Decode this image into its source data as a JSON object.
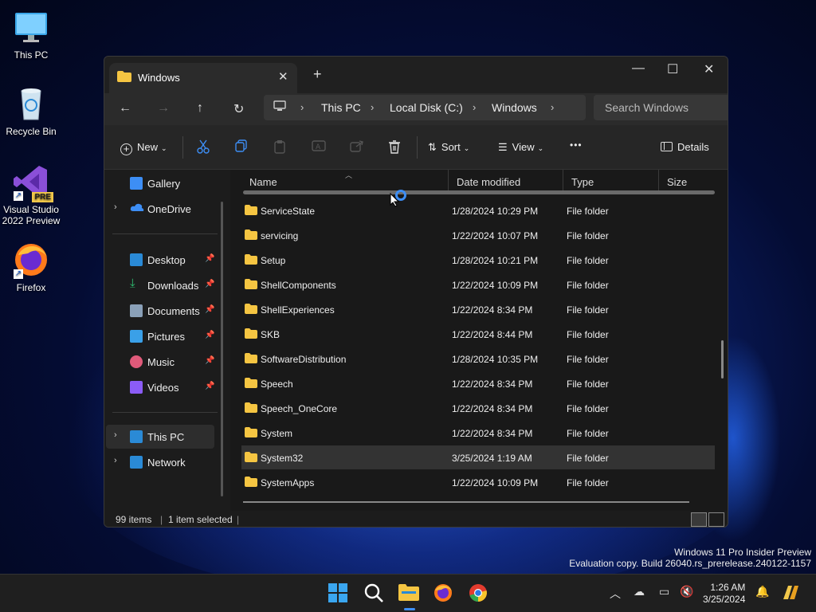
{
  "desktop": {
    "icons": [
      {
        "label": "This PC",
        "icon": "monitor-icon"
      },
      {
        "label": "Recycle Bin",
        "icon": "recycle-bin-icon"
      },
      {
        "label": "Visual Studio 2022 Preview",
        "badge": "PRE",
        "icon": "visual-studio-icon"
      },
      {
        "label": "Firefox",
        "icon": "firefox-icon"
      }
    ],
    "watermark_line1": "Windows 11 Pro Insider Preview",
    "watermark_line2": "Evaluation copy. Build 26040.rs_prerelease.240122-1157"
  },
  "explorer": {
    "tab_title": "Windows",
    "tab_close": "✕",
    "new_tab": "+",
    "window_controls": {
      "minimize": "—",
      "maximize": "☐",
      "close": "✕"
    },
    "nav": {
      "back": "←",
      "forward": "→",
      "up": "↑",
      "refresh": "↻"
    },
    "address": {
      "sep": "›",
      "crumbs": [
        "This PC",
        "Local Disk (C:)",
        "Windows"
      ]
    },
    "search_placeholder": "Search Windows",
    "toolbar": {
      "new_label": "New",
      "sort_label": "Sort",
      "view_label": "View",
      "more": "•••",
      "details_label": "Details"
    },
    "sidebar": {
      "items": [
        {
          "label": "Gallery",
          "icon": "gallery-icon",
          "color": "#3d8ef5"
        },
        {
          "label": "OneDrive",
          "icon": "onedrive-icon",
          "color": "#3d8ef5"
        },
        {
          "label": "Desktop",
          "icon": "desktop-icon",
          "color": "#2a8ad6"
        },
        {
          "label": "Downloads",
          "icon": "download-icon",
          "color": "#2fbf71"
        },
        {
          "label": "Documents",
          "icon": "documents-icon",
          "color": "#8aa0b8"
        },
        {
          "label": "Pictures",
          "icon": "pictures-icon",
          "color": "#3aa0e8"
        },
        {
          "label": "Music",
          "icon": "music-icon",
          "color": "#e05a7a"
        },
        {
          "label": "Videos",
          "icon": "videos-icon",
          "color": "#8b5cf6"
        },
        {
          "label": "This PC",
          "icon": "this-pc-icon",
          "color": "#2a8ad6"
        },
        {
          "label": "Network",
          "icon": "network-icon",
          "color": "#2a8ad6"
        }
      ]
    },
    "columns": {
      "name": "Name",
      "date": "Date modified",
      "type": "Type",
      "size": "Size"
    },
    "rows": [
      {
        "name": "ServiceState",
        "date": "1/28/2024 10:29 PM",
        "type": "File folder"
      },
      {
        "name": "servicing",
        "date": "1/22/2024 10:07 PM",
        "type": "File folder"
      },
      {
        "name": "Setup",
        "date": "1/28/2024 10:21 PM",
        "type": "File folder"
      },
      {
        "name": "ShellComponents",
        "date": "1/22/2024 10:09 PM",
        "type": "File folder"
      },
      {
        "name": "ShellExperiences",
        "date": "1/22/2024 8:34 PM",
        "type": "File folder"
      },
      {
        "name": "SKB",
        "date": "1/22/2024 8:44 PM",
        "type": "File folder"
      },
      {
        "name": "SoftwareDistribution",
        "date": "1/28/2024 10:35 PM",
        "type": "File folder"
      },
      {
        "name": "Speech",
        "date": "1/22/2024 8:34 PM",
        "type": "File folder"
      },
      {
        "name": "Speech_OneCore",
        "date": "1/22/2024 8:34 PM",
        "type": "File folder"
      },
      {
        "name": "System",
        "date": "1/22/2024 8:34 PM",
        "type": "File folder"
      },
      {
        "name": "System32",
        "date": "3/25/2024 1:19 AM",
        "type": "File folder"
      },
      {
        "name": "SystemApps",
        "date": "1/22/2024 10:09 PM",
        "type": "File folder"
      }
    ],
    "status": {
      "items": "99 items",
      "selected": "1 item selected"
    }
  },
  "taskbar": {
    "time": "1:26 AM",
    "date": "3/25/2024"
  }
}
